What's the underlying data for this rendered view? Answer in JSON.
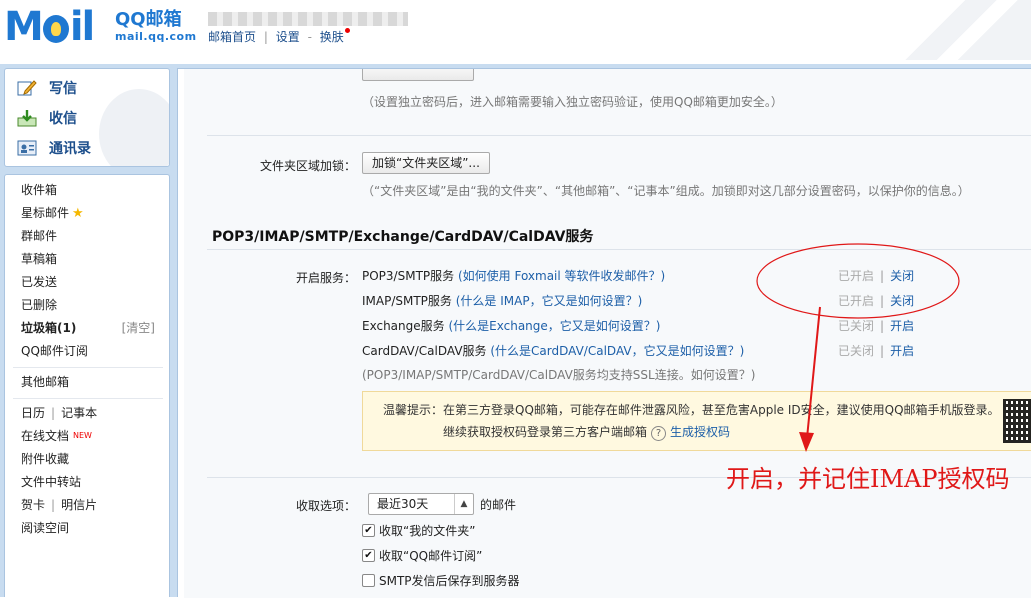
{
  "header": {
    "logo_brand": "QQ邮箱",
    "logo_domain": "mail.qq.com",
    "links": {
      "home": "邮箱首页",
      "settings": "设置",
      "skin": "换肤"
    },
    "sep": "|",
    "dash": "-"
  },
  "sidebar": {
    "quick": {
      "compose": "写信",
      "receive": "收信",
      "contacts": "通讯录"
    },
    "inbox": "收件箱",
    "starred": "星标邮件",
    "group": "群邮件",
    "drafts": "草稿箱",
    "sent": "已发送",
    "deleted": "已删除",
    "junk": "垃圾箱(1)",
    "clear": "[清空]",
    "subscriptions": "QQ邮件订阅",
    "other_mailboxes": "其他邮箱",
    "calendar": "日历",
    "notes": "记事本",
    "online_docs": "在线文档",
    "new_badge": "NEW",
    "attachments": "附件收藏",
    "file_transfer": "文件中转站",
    "cards": "贺卡",
    "postcards": "明信片",
    "reading": "阅读空间",
    "pipe": "|"
  },
  "main": {
    "top_hint": "（设置独立密码后，进入邮箱需要输入独立密码验证，使用QQ邮箱更加安全。）",
    "folder_lock_label": "文件夹区域加锁：",
    "folder_lock_button": "加锁“文件夹区域”...",
    "folder_lock_hint": "（“文件夹区域”是由“我的文件夹”、“其他邮箱”、“记事本”组成。加锁即对这几部分设置密码，以保护你的信息。）",
    "section_title": "POP3/IMAP/SMTP/Exchange/CardDAV/CalDAV服务",
    "open_service_label": "开启服务：",
    "services": [
      {
        "name": "POP3/SMTP服务",
        "help": "(如何使用 Foxmail 等软件收发邮件？)",
        "status": "已开启",
        "action": "关闭"
      },
      {
        "name": "IMAP/SMTP服务",
        "help": "(什么是 IMAP，它又是如何设置？)",
        "status": "已开启",
        "action": "关闭"
      },
      {
        "name": "Exchange服务",
        "help": "(什么是Exchange，它又是如何设置？)",
        "status": "已关闭",
        "action": "开启"
      },
      {
        "name": "CardDAV/CalDAV服务",
        "help": "(什么是CardDAV/CalDAV，它又是如何设置？)",
        "status": "已关闭",
        "action": "开启"
      }
    ],
    "status_sep": "|",
    "ssl_hint": "(POP3/IMAP/SMTP/CardDAV/CalDAV服务均支持SSL连接。如何设置？)",
    "warning": {
      "line1": "温馨提示：在第三方登录QQ邮箱，可能存在邮件泄露风险，甚至危害Apple ID安全，建议使用QQ邮箱手机版登录。",
      "line2": "继续获取授权码登录第三方客户端邮箱",
      "help_glyph": "?",
      "link": "生成授权码"
    },
    "receive_label": "收取选项：",
    "receive_select": "最近30天",
    "receive_suffix": "的邮件",
    "checkboxes": [
      {
        "label": "收取“我的文件夹”",
        "checked": true
      },
      {
        "label": "收取“QQ邮件订阅”",
        "checked": true
      },
      {
        "label": "SMTP发信后保存到服务器",
        "checked": false
      }
    ],
    "check_glyph": "✔"
  },
  "annotation": {
    "text": "开启，并记住IMAP授权码",
    "color": "#e01818"
  },
  "colors": {
    "brand_blue": "#1f78d1",
    "link_blue": "#1d5fa8",
    "frame_blue": "#c8dcf0",
    "warning_bg": "#fff9e0"
  }
}
